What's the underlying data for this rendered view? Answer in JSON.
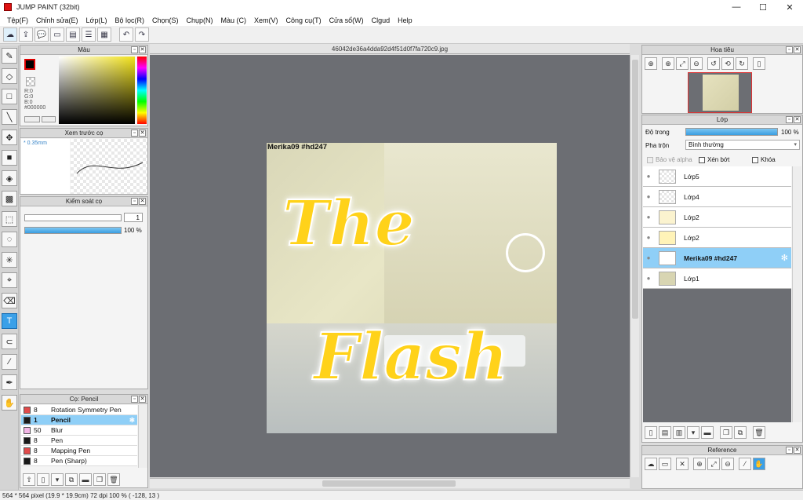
{
  "window": {
    "title": "JUMP PAINT (32bit)",
    "minimize": "—",
    "maximize": "☐",
    "close": "✕"
  },
  "menu": [
    "Tệp(F)",
    "Chỉnh sửa(E)",
    "Lớp(L)",
    "Bộ lọc(R)",
    "Chọn(S)",
    "Chụp(N)",
    "Màu (C)",
    "Xem(V)",
    "Công cụ(T)",
    "Cửa sổ(W)",
    "Clgud",
    "Help"
  ],
  "document": {
    "tab_title": "46042de36a4dda92d4f51d0f7fa720c9.jpg",
    "image_caption": "Merika09  #hd247",
    "word1": "The",
    "word2": "Flash"
  },
  "color_panel": {
    "title": "Màu",
    "r": "R:0",
    "g": "G:0",
    "b": "B:0",
    "hex": "#000000",
    "fg_color": "#000000"
  },
  "preview_panel": {
    "title": "Xem trước cọ",
    "size": "* 0.35mm"
  },
  "brush_control": {
    "title": "Kiểm soát cọ",
    "size_value": "1",
    "opacity_label": "100 %",
    "opacity": 100
  },
  "brush_list": {
    "title": "Cọ: Pencil",
    "items": [
      {
        "color": "#e24b4b",
        "size": "8",
        "name": "Rotation Symmetry Pen"
      },
      {
        "color": "#1a1a1a",
        "size": "1",
        "name": "Pencil"
      },
      {
        "color": "#f3b6e6",
        "size": "50",
        "name": "Blur"
      },
      {
        "color": "#1a1a1a",
        "size": "8",
        "name": "Pen"
      },
      {
        "color": "#e24b4b",
        "size": "8",
        "name": "Mapping Pen"
      },
      {
        "color": "#1a1a1a",
        "size": "8",
        "name": "Pen (Sharp)"
      }
    ]
  },
  "navigator": {
    "title": "Hoa tiêu"
  },
  "layers": {
    "title": "Lớp",
    "opacity_label": "Độ trong",
    "opacity_value": "100 %",
    "opacity": 100,
    "blend_label": "Pha trộn",
    "blend_value": "Bình thường",
    "protect_alpha": "Bảo vệ alpha",
    "clip": "Xén bớt",
    "lock": "Khóa",
    "items": [
      {
        "name": "Lớp5"
      },
      {
        "name": "Lớp4"
      },
      {
        "name": "Lớp2"
      },
      {
        "name": "Lớp2"
      },
      {
        "name": "Merika09  #hd247"
      },
      {
        "name": "Lớp1"
      }
    ]
  },
  "reference": {
    "title": "Reference"
  },
  "status": {
    "text": "564 * 564 pixel   (19.9 * 19.9cm)   72 dpi   100 %   ( -128, 13 )"
  }
}
